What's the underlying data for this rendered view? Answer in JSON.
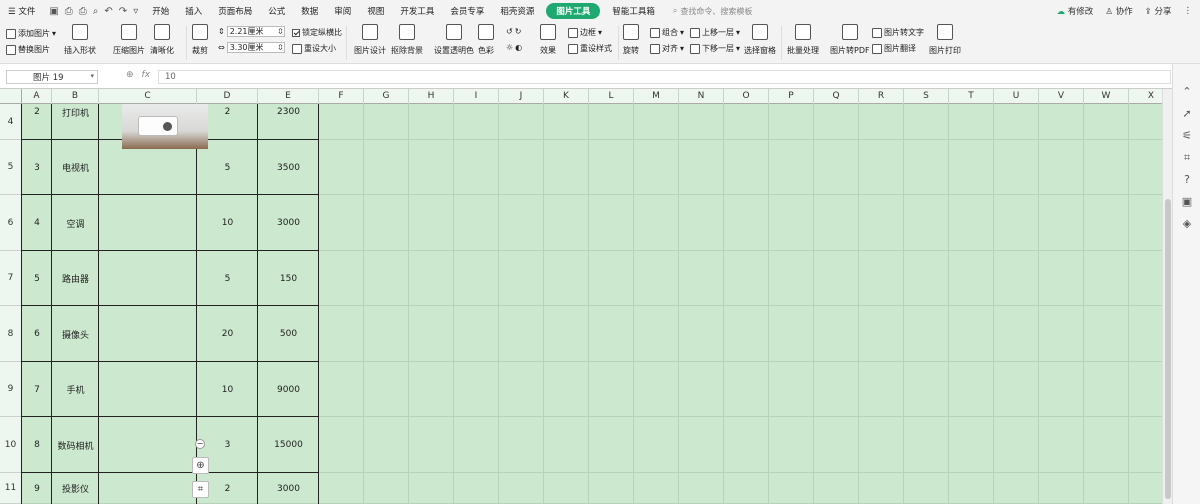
{
  "menu": {
    "file": "文件",
    "tabs": [
      "开始",
      "插入",
      "页面布局",
      "公式",
      "数据",
      "审阅",
      "视图",
      "开发工具",
      "会员专享",
      "稻壳资源"
    ],
    "active_tab": "图片工具",
    "smart_tab": "智能工具箱",
    "search_placeholder": "查找命令、搜索模板",
    "changes": "有修改",
    "collab": "协作",
    "share": "分享"
  },
  "ribbon": {
    "add_picture": "添加图片",
    "replace_picture": "替换图片",
    "insert_shape": "插入形状",
    "compress": "压缩图片",
    "sharpen": "清晰化",
    "crop": "裁剪",
    "height": "2.21厘米",
    "width": "3.30厘米",
    "lock_ratio": "锁定纵横比",
    "reset_size": "重设大小",
    "picture_design": "图片设计",
    "remove_bg": "抠除背景",
    "set_transparent": "设置透明色",
    "color": "色彩",
    "effects": "效果",
    "border": "边框",
    "reset_style": "重设样式",
    "rotate": "旋转",
    "group": "组合",
    "align": "对齐",
    "bring_forward": "上移一层",
    "send_backward": "下移一层",
    "selection_pane": "选择窗格",
    "batch": "批量处理",
    "to_pdf": "图片转PDF",
    "to_text": "图片转文字",
    "translate": "图片翻译",
    "print": "图片打印"
  },
  "formula_bar": {
    "name_box": "图片 19",
    "fx": "fx",
    "value": "10"
  },
  "columns": [
    "A",
    "B",
    "C",
    "D",
    "E",
    "F",
    "G",
    "H",
    "I",
    "J",
    "K",
    "L",
    "M",
    "N",
    "O",
    "P",
    "Q",
    "R",
    "S",
    "T",
    "U",
    "V",
    "W",
    "X"
  ],
  "rows": [
    {
      "num": "4",
      "a": "2",
      "b": "打印机",
      "d": "2",
      "e": "2300"
    },
    {
      "num": "5",
      "a": "3",
      "b": "电视机",
      "d": "5",
      "e": "3500"
    },
    {
      "num": "6",
      "a": "4",
      "b": "空调",
      "d": "10",
      "e": "3000"
    },
    {
      "num": "7",
      "a": "5",
      "b": "路由器",
      "d": "5",
      "e": "150"
    },
    {
      "num": "8",
      "a": "6",
      "b": "摄像头",
      "d": "20",
      "e": "500"
    },
    {
      "num": "9",
      "a": "7",
      "b": "手机",
      "d": "10",
      "e": "9000"
    },
    {
      "num": "10",
      "a": "8",
      "b": "数码相机",
      "d": "3",
      "e": "15000"
    },
    {
      "num": "11",
      "a": "9",
      "b": "投影仪",
      "d": "2",
      "e": "3000"
    }
  ],
  "colors": {
    "sheet_bg": "#cce8cf",
    "accent": "#1fa971"
  }
}
